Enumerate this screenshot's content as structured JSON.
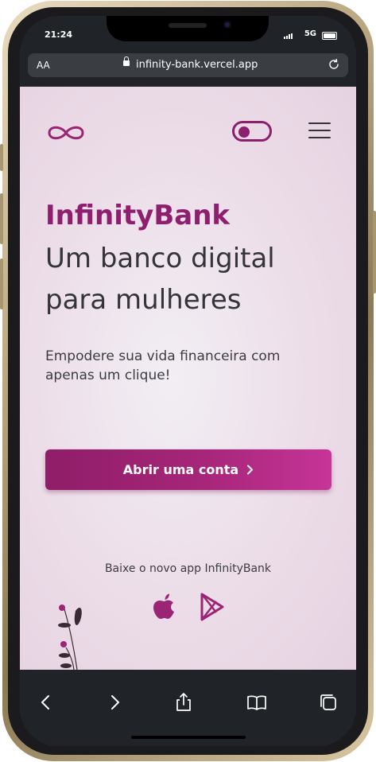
{
  "status_bar": {
    "time": "21:24",
    "network": "5G"
  },
  "browser": {
    "text_size_label": "AA",
    "url": "infinity-bank.vercel.app"
  },
  "page": {
    "brand": "InfinityBank",
    "headline": "Um banco digital para mulheres",
    "subtitle": "Empodere sua vida financeira com apenas um clique!",
    "cta_label": "Abrir uma conta",
    "download_label": "Baixe o novo app InfinityBank",
    "icons": [
      "infinity-logo",
      "theme-toggle",
      "hamburger-menu",
      "chevron-right",
      "apple-logo",
      "google-play-logo",
      "flower-illustration"
    ],
    "colors": {
      "brand": "#8e1f6f",
      "button_start": "#8f1d68",
      "button_end": "#c63497",
      "background": "#ecdde8",
      "text": "#34343a"
    }
  },
  "toolbar": {
    "icons": [
      "back-icon",
      "forward-icon",
      "share-icon",
      "bookmarks-icon",
      "tabs-icon"
    ]
  }
}
